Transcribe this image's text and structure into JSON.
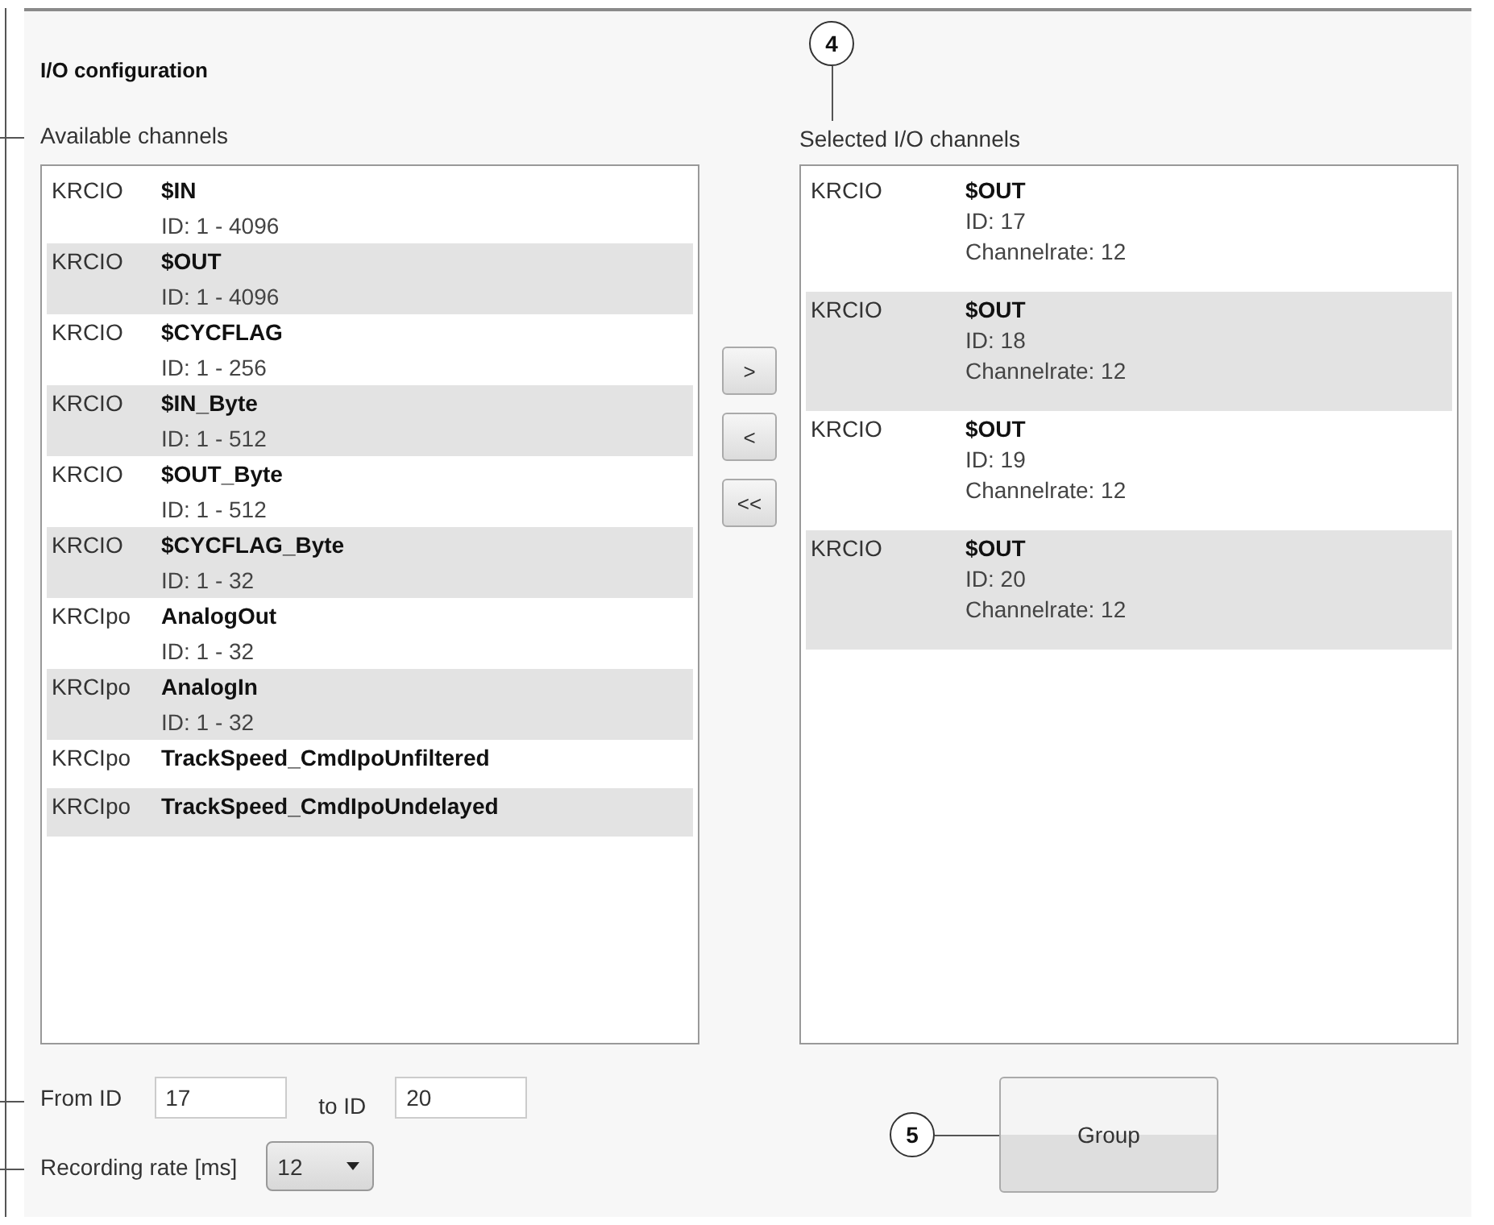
{
  "title": "I/O configuration",
  "available": {
    "label": "Available channels",
    "channels": [
      {
        "source": "KRCIO",
        "name": "$IN",
        "id_range": "ID: 1 - 4096"
      },
      {
        "source": "KRCIO",
        "name": "$OUT",
        "id_range": "ID: 1 - 4096"
      },
      {
        "source": "KRCIO",
        "name": "$CYCFLAG",
        "id_range": "ID: 1 - 256"
      },
      {
        "source": "KRCIO",
        "name": "$IN_Byte",
        "id_range": "ID: 1 - 512"
      },
      {
        "source": "KRCIO",
        "name": "$OUT_Byte",
        "id_range": "ID: 1 - 512"
      },
      {
        "source": "KRCIO",
        "name": "$CYCFLAG_Byte",
        "id_range": "ID: 1 - 32"
      },
      {
        "source": "KRCIpo",
        "name": "AnalogOut",
        "id_range": "ID: 1 - 32"
      },
      {
        "source": "KRCIpo",
        "name": "AnalogIn",
        "id_range": "ID: 1 - 32"
      },
      {
        "source": "KRCIpo",
        "name": "TrackSpeed_CmdIpoUnfiltered"
      },
      {
        "source": "KRCIpo",
        "name": "TrackSpeed_CmdIpoUndelayed"
      }
    ]
  },
  "transfer_buttons": [
    ">",
    "<",
    "<<"
  ],
  "selected_channels": {
    "callout": "4",
    "label": "Selected I/O channels",
    "channels": [
      {
        "source": "KRCIO",
        "name": "$OUT",
        "id": "ID: 17",
        "rate": "Channelrate: 12"
      },
      {
        "source": "KRCIO",
        "name": "$OUT",
        "id": "ID: 18",
        "rate": "Channelrate: 12"
      },
      {
        "source": "KRCIO",
        "name": "$OUT",
        "id": "ID: 19",
        "rate": "Channelrate: 12"
      },
      {
        "source": "KRCIO",
        "name": "$OUT",
        "id": "ID: 20",
        "rate": "Channelrate: 12"
      }
    ]
  },
  "from_id": {
    "label": "From ID",
    "value": "17"
  },
  "to_id": {
    "label": "to ID",
    "value": "20"
  },
  "recording_rate": {
    "label": "Recording rate [ms]",
    "value": "12"
  },
  "group_button": {
    "callout": "5",
    "label": "Group"
  }
}
